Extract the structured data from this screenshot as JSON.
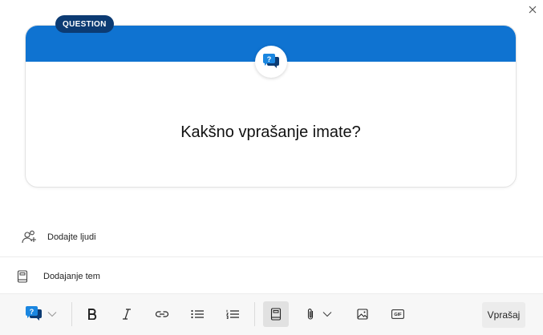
{
  "card": {
    "badge_label": "QUESTION",
    "title": "Kakšno vprašanje imate?",
    "banner_color": "#0f73d1",
    "badge_color": "#0c3b73",
    "icon": "question-bubble-icon"
  },
  "people": {
    "label": "Dodajte ljudi",
    "icon": "add-people-icon"
  },
  "topic": {
    "label": "Dodajanje tem",
    "icon": "book-icon"
  },
  "toolbar": {
    "items": [
      "question-type-icon",
      "bold-icon",
      "italic-icon",
      "link-icon",
      "bulleted-list-icon",
      "numbered-list-icon",
      "book-icon",
      "attach-icon",
      "image-icon",
      "gif-icon"
    ],
    "gif_label": "GIF",
    "submit_label": "Vprašaj"
  }
}
